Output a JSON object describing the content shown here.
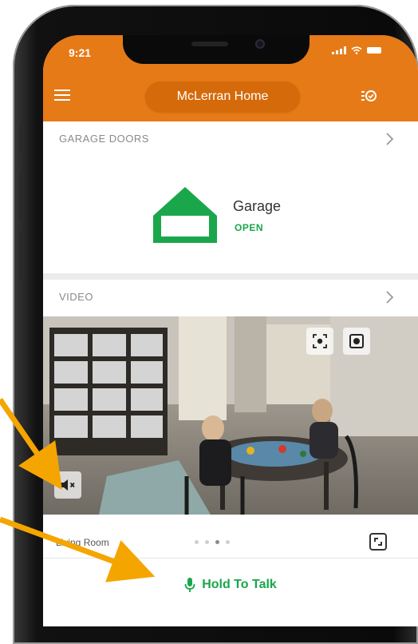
{
  "status": {
    "time": "9:21"
  },
  "nav": {
    "home_name": "McLerran Home"
  },
  "garage": {
    "section_title": "GARAGE DOORS",
    "door_name": "Garage",
    "door_status": "OPEN"
  },
  "video": {
    "section_title": "VIDEO",
    "camera_name": "Living Room",
    "page_count": 4,
    "current_page": 3,
    "talk_label": "Hold To Talk"
  },
  "colors": {
    "brand_orange": "#e67a16",
    "open_green": "#1aa64b",
    "annotation_arrow": "#f5a500"
  },
  "icons": [
    "menu-icon",
    "activity-icon",
    "chevron-right-icon",
    "garage-icon",
    "screenshot-icon",
    "record-icon",
    "mute-icon",
    "expand-icon",
    "microphone-icon"
  ]
}
